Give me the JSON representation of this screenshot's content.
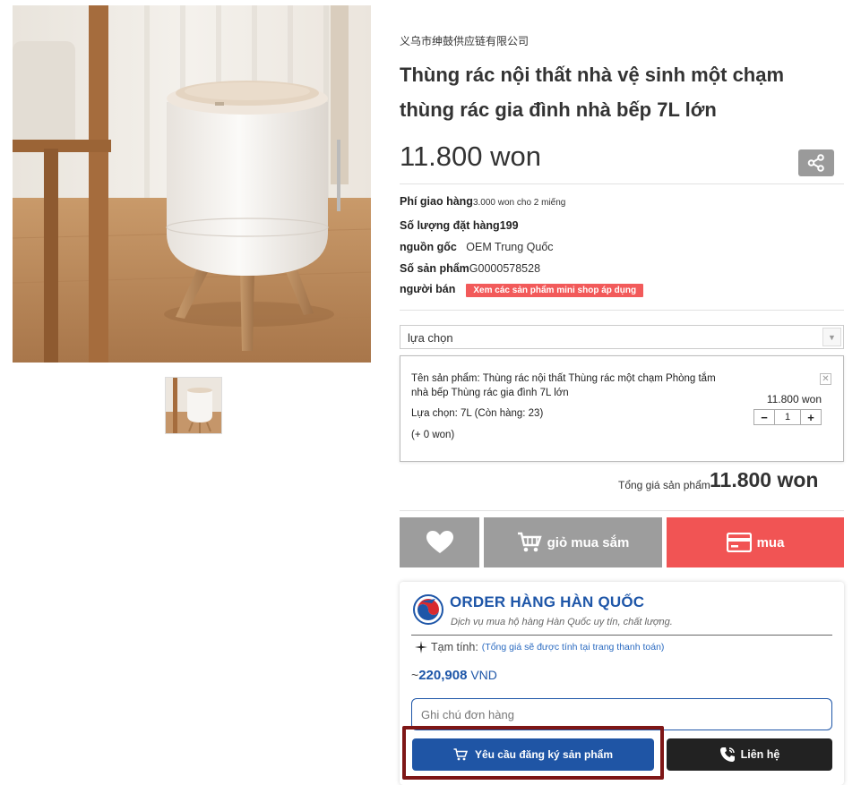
{
  "seller_name_cn": "义乌市绅鼓供应链有限公司",
  "product": {
    "title": "Thùng rác nội thất nhà vệ sinh một chạm thùng rác gia đình nhà bếp 7L lớn",
    "price": "11.800 won"
  },
  "info": {
    "shipping_label": "Phí giao hàng",
    "shipping_value": "3.000 won cho 2 miếng",
    "order_qty_label": "Số lượng đặt hàng",
    "order_qty_value": "199",
    "origin_label": "nguồn gốc",
    "origin_value": "OEM Trung Quốc",
    "product_no_label": "Số sản phẩm",
    "product_no_value": "G0000578528",
    "seller_label": "người bán",
    "seller_badge": "Xem các sản phẩm mini shop áp dụng"
  },
  "option_select": {
    "value": "lựa chọn"
  },
  "option_card": {
    "name": "Tên sản phẩm: Thùng rác nội thất Thùng rác một chạm Phòng tắm nhà bếp Thùng rác gia đình 7L lớn",
    "choice": "Lựa chọn: 7L (Còn hàng: 23)",
    "extra": "(+ 0 won)",
    "price": "11.800 won",
    "quantity": "1",
    "minus": "−",
    "plus": "+",
    "close": "✕"
  },
  "total": {
    "label": "Tổng giá sản phẩm",
    "value": "11.800 won"
  },
  "actions": {
    "cart_label": "giỏ mua sắm",
    "buy_label": "mua"
  },
  "order_box": {
    "title": "ORDER HÀNG HÀN QUỐC",
    "subtitle": "Dịch vụ mua hộ hàng Hàn Quốc uy tín, chất lượng.",
    "estimate_label": "Tạm tính:",
    "estimate_note": "(Tổng giá sẽ được tính tại trang thanh toán)",
    "vnd_prefix": "~",
    "vnd_amount": "220,908",
    "vnd_currency": "VND",
    "note_placeholder": "Ghi chú đơn hàng",
    "request_label": "Yêu cầu đăng ký sản phẩm",
    "contact_label": "Liên hệ"
  },
  "colors": {
    "buy_red": "#f15454",
    "gray_button": "#9d9d9d",
    "brand_blue": "#1f55a5",
    "highlight": "#7e1616"
  },
  "icons": [
    "share-icon",
    "heart-icon",
    "cart-icon",
    "card-icon",
    "cart-icon",
    "phone-icon",
    "close-icon",
    "chevron-down-icon",
    "sparkle-icon"
  ]
}
